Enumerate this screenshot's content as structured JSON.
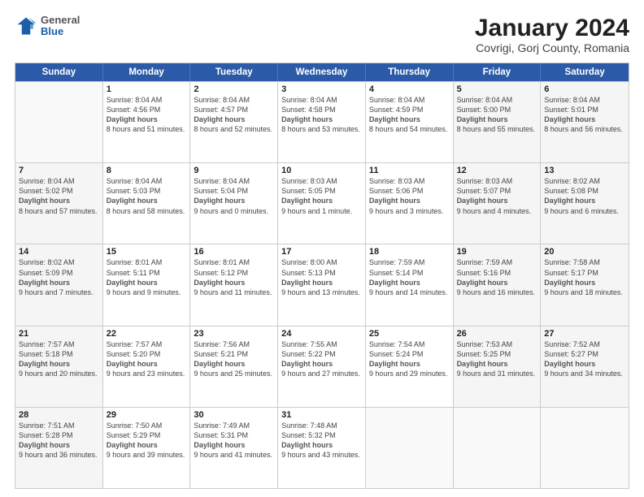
{
  "logo": {
    "general": "General",
    "blue": "Blue"
  },
  "title": "January 2024",
  "subtitle": "Covrigi, Gorj County, Romania",
  "weekdays": [
    "Sunday",
    "Monday",
    "Tuesday",
    "Wednesday",
    "Thursday",
    "Friday",
    "Saturday"
  ],
  "weeks": [
    [
      {
        "day": "",
        "sunrise": "",
        "sunset": "",
        "daylight": "",
        "shaded": false,
        "empty": true
      },
      {
        "day": "1",
        "sunrise": "8:04 AM",
        "sunset": "4:56 PM",
        "daylight": "8 hours and 51 minutes.",
        "shaded": false,
        "empty": false
      },
      {
        "day": "2",
        "sunrise": "8:04 AM",
        "sunset": "4:57 PM",
        "daylight": "8 hours and 52 minutes.",
        "shaded": false,
        "empty": false
      },
      {
        "day": "3",
        "sunrise": "8:04 AM",
        "sunset": "4:58 PM",
        "daylight": "8 hours and 53 minutes.",
        "shaded": false,
        "empty": false
      },
      {
        "day": "4",
        "sunrise": "8:04 AM",
        "sunset": "4:59 PM",
        "daylight": "8 hours and 54 minutes.",
        "shaded": false,
        "empty": false
      },
      {
        "day": "5",
        "sunrise": "8:04 AM",
        "sunset": "5:00 PM",
        "daylight": "8 hours and 55 minutes.",
        "shaded": true,
        "empty": false
      },
      {
        "day": "6",
        "sunrise": "8:04 AM",
        "sunset": "5:01 PM",
        "daylight": "8 hours and 56 minutes.",
        "shaded": true,
        "empty": false
      }
    ],
    [
      {
        "day": "7",
        "sunrise": "8:04 AM",
        "sunset": "5:02 PM",
        "daylight": "8 hours and 57 minutes.",
        "shaded": true,
        "empty": false
      },
      {
        "day": "8",
        "sunrise": "8:04 AM",
        "sunset": "5:03 PM",
        "daylight": "8 hours and 58 minutes.",
        "shaded": false,
        "empty": false
      },
      {
        "day": "9",
        "sunrise": "8:04 AM",
        "sunset": "5:04 PM",
        "daylight": "9 hours and 0 minutes.",
        "shaded": false,
        "empty": false
      },
      {
        "day": "10",
        "sunrise": "8:03 AM",
        "sunset": "5:05 PM",
        "daylight": "9 hours and 1 minute.",
        "shaded": false,
        "empty": false
      },
      {
        "day": "11",
        "sunrise": "8:03 AM",
        "sunset": "5:06 PM",
        "daylight": "9 hours and 3 minutes.",
        "shaded": false,
        "empty": false
      },
      {
        "day": "12",
        "sunrise": "8:03 AM",
        "sunset": "5:07 PM",
        "daylight": "9 hours and 4 minutes.",
        "shaded": true,
        "empty": false
      },
      {
        "day": "13",
        "sunrise": "8:02 AM",
        "sunset": "5:08 PM",
        "daylight": "9 hours and 6 minutes.",
        "shaded": true,
        "empty": false
      }
    ],
    [
      {
        "day": "14",
        "sunrise": "8:02 AM",
        "sunset": "5:09 PM",
        "daylight": "9 hours and 7 minutes.",
        "shaded": true,
        "empty": false
      },
      {
        "day": "15",
        "sunrise": "8:01 AM",
        "sunset": "5:11 PM",
        "daylight": "9 hours and 9 minutes.",
        "shaded": false,
        "empty": false
      },
      {
        "day": "16",
        "sunrise": "8:01 AM",
        "sunset": "5:12 PM",
        "daylight": "9 hours and 11 minutes.",
        "shaded": false,
        "empty": false
      },
      {
        "day": "17",
        "sunrise": "8:00 AM",
        "sunset": "5:13 PM",
        "daylight": "9 hours and 13 minutes.",
        "shaded": false,
        "empty": false
      },
      {
        "day": "18",
        "sunrise": "7:59 AM",
        "sunset": "5:14 PM",
        "daylight": "9 hours and 14 minutes.",
        "shaded": false,
        "empty": false
      },
      {
        "day": "19",
        "sunrise": "7:59 AM",
        "sunset": "5:16 PM",
        "daylight": "9 hours and 16 minutes.",
        "shaded": true,
        "empty": false
      },
      {
        "day": "20",
        "sunrise": "7:58 AM",
        "sunset": "5:17 PM",
        "daylight": "9 hours and 18 minutes.",
        "shaded": true,
        "empty": false
      }
    ],
    [
      {
        "day": "21",
        "sunrise": "7:57 AM",
        "sunset": "5:18 PM",
        "daylight": "9 hours and 20 minutes.",
        "shaded": true,
        "empty": false
      },
      {
        "day": "22",
        "sunrise": "7:57 AM",
        "sunset": "5:20 PM",
        "daylight": "9 hours and 23 minutes.",
        "shaded": false,
        "empty": false
      },
      {
        "day": "23",
        "sunrise": "7:56 AM",
        "sunset": "5:21 PM",
        "daylight": "9 hours and 25 minutes.",
        "shaded": false,
        "empty": false
      },
      {
        "day": "24",
        "sunrise": "7:55 AM",
        "sunset": "5:22 PM",
        "daylight": "9 hours and 27 minutes.",
        "shaded": false,
        "empty": false
      },
      {
        "day": "25",
        "sunrise": "7:54 AM",
        "sunset": "5:24 PM",
        "daylight": "9 hours and 29 minutes.",
        "shaded": false,
        "empty": false
      },
      {
        "day": "26",
        "sunrise": "7:53 AM",
        "sunset": "5:25 PM",
        "daylight": "9 hours and 31 minutes.",
        "shaded": true,
        "empty": false
      },
      {
        "day": "27",
        "sunrise": "7:52 AM",
        "sunset": "5:27 PM",
        "daylight": "9 hours and 34 minutes.",
        "shaded": true,
        "empty": false
      }
    ],
    [
      {
        "day": "28",
        "sunrise": "7:51 AM",
        "sunset": "5:28 PM",
        "daylight": "9 hours and 36 minutes.",
        "shaded": true,
        "empty": false
      },
      {
        "day": "29",
        "sunrise": "7:50 AM",
        "sunset": "5:29 PM",
        "daylight": "9 hours and 39 minutes.",
        "shaded": false,
        "empty": false
      },
      {
        "day": "30",
        "sunrise": "7:49 AM",
        "sunset": "5:31 PM",
        "daylight": "9 hours and 41 minutes.",
        "shaded": false,
        "empty": false
      },
      {
        "day": "31",
        "sunrise": "7:48 AM",
        "sunset": "5:32 PM",
        "daylight": "9 hours and 43 minutes.",
        "shaded": false,
        "empty": false
      },
      {
        "day": "",
        "sunrise": "",
        "sunset": "",
        "daylight": "",
        "shaded": false,
        "empty": true
      },
      {
        "day": "",
        "sunrise": "",
        "sunset": "",
        "daylight": "",
        "shaded": false,
        "empty": true
      },
      {
        "day": "",
        "sunrise": "",
        "sunset": "",
        "daylight": "",
        "shaded": false,
        "empty": true
      }
    ]
  ]
}
